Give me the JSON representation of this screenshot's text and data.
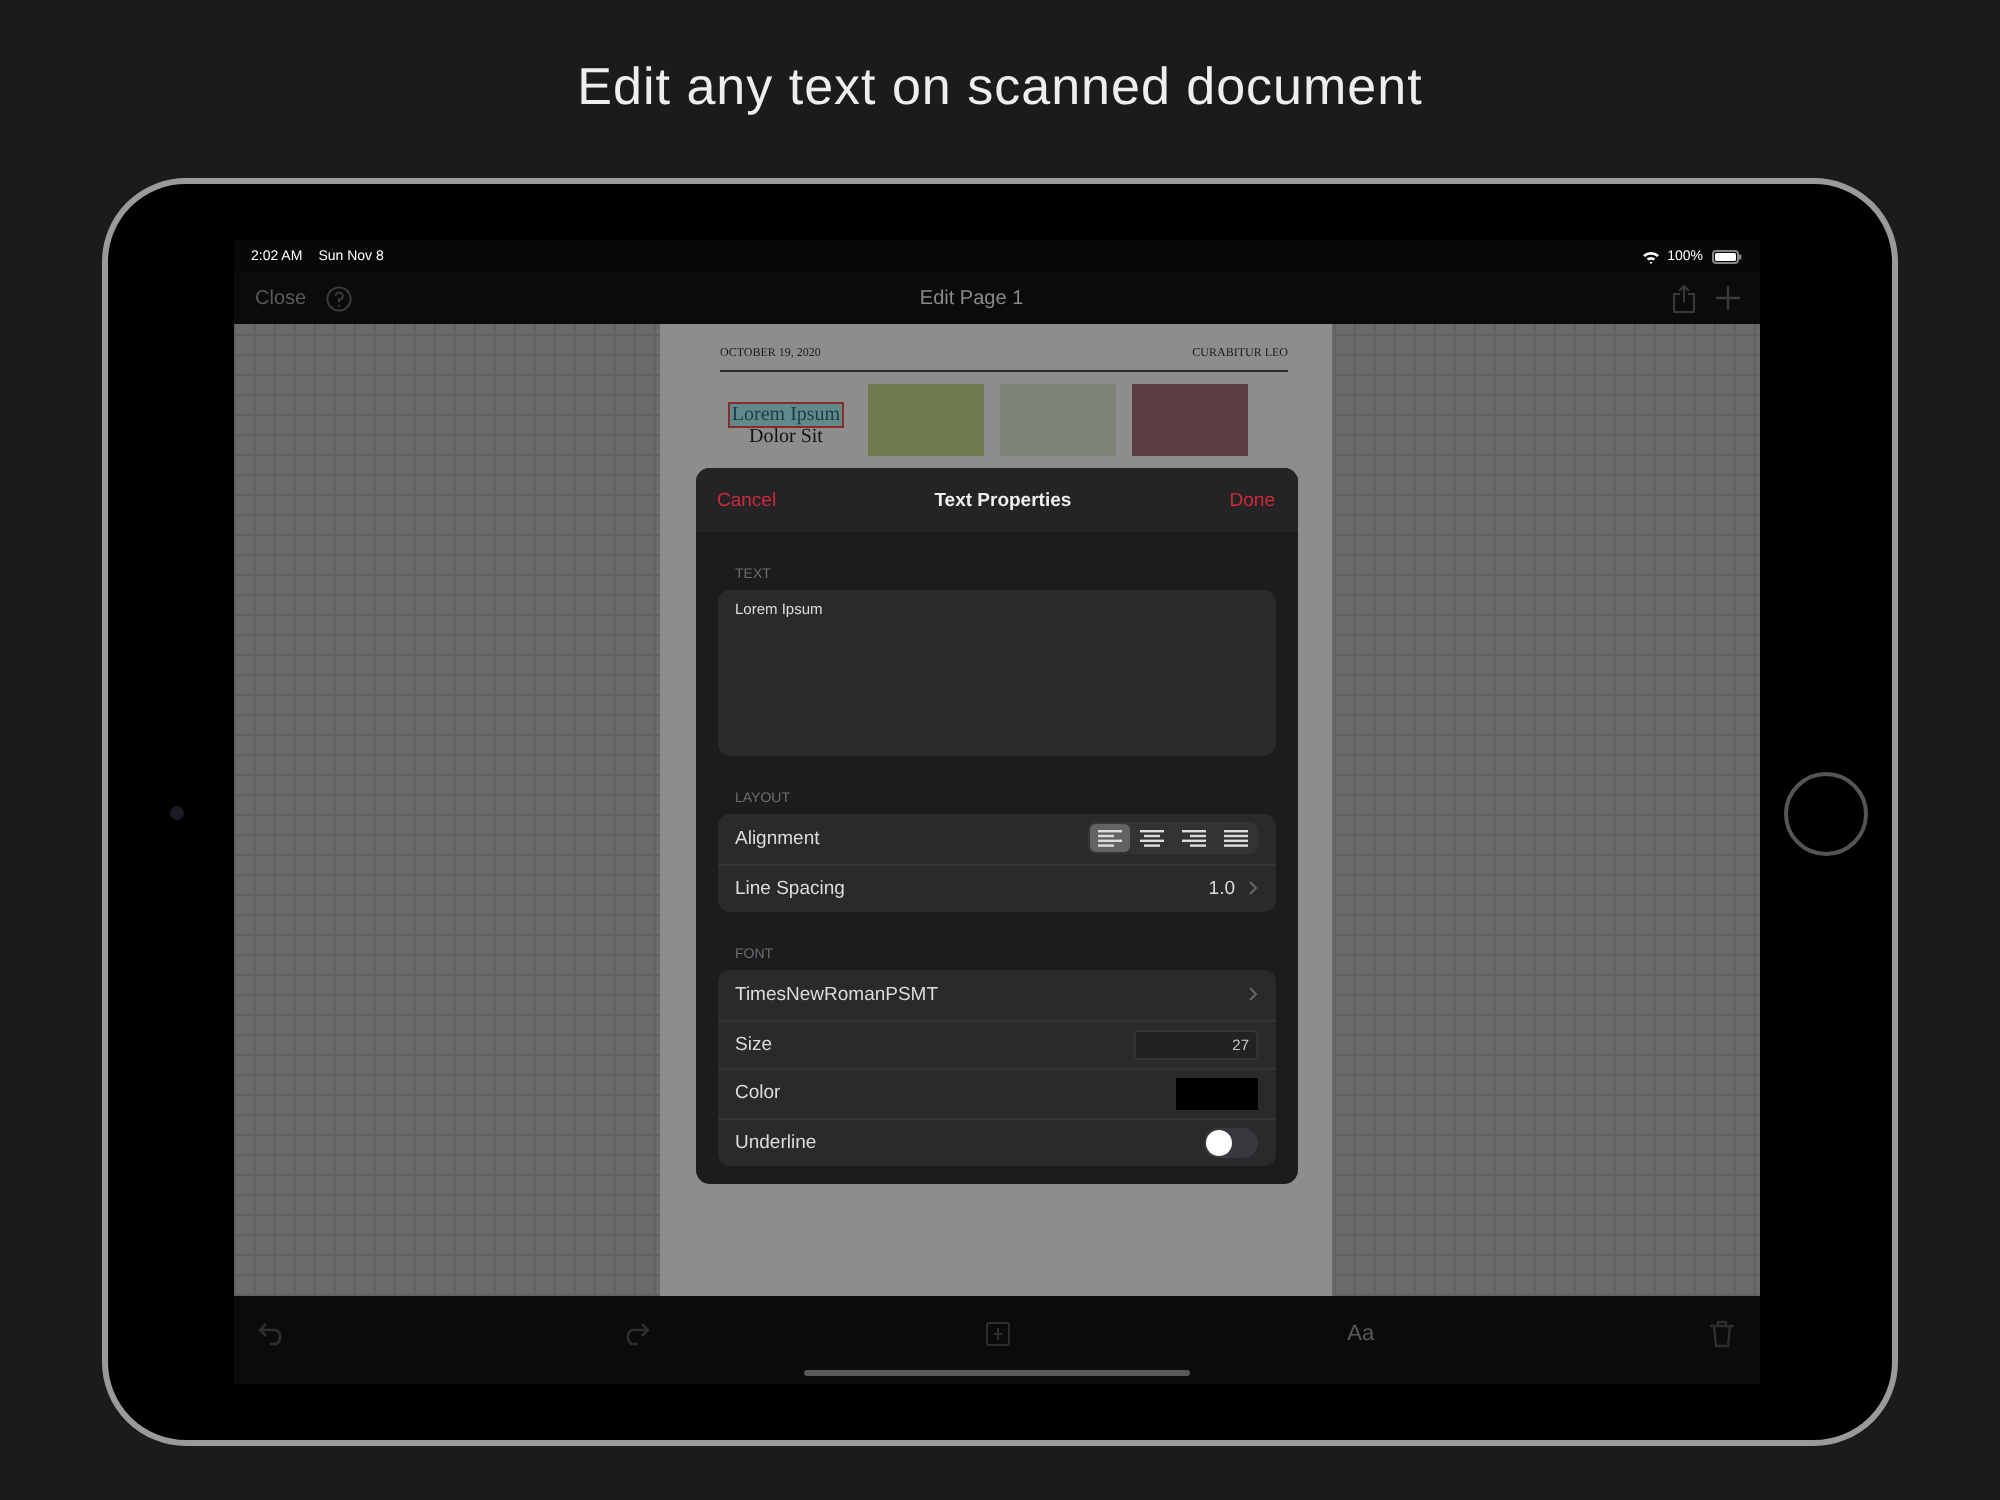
{
  "headline": "Edit any text on scanned document",
  "status_bar": {
    "time": "2:02 AM",
    "date": "Sun Nov 8",
    "battery": "100%"
  },
  "nav_bar": {
    "left": "Close",
    "title": "Edit Page 1"
  },
  "document": {
    "date": "OCTOBER 19, 2020",
    "section": "CURABITUR LEO",
    "title": "Lorem Ipsum",
    "subtitle": "Dolor Sit"
  },
  "sheet": {
    "cancel": "Cancel",
    "title": "Text Properties",
    "done": "Done",
    "text_section": {
      "label": "TEXT",
      "value": "Lorem Ipsum"
    },
    "layout_section": {
      "label": "LAYOUT",
      "alignment_label": "Alignment",
      "alignments": [
        {
          "kind": "left",
          "selected": true
        },
        {
          "kind": "center",
          "selected": false
        },
        {
          "kind": "right",
          "selected": false
        },
        {
          "kind": "justify",
          "selected": false
        }
      ],
      "line_spacing_label": "Line Spacing",
      "line_spacing": "1.0"
    },
    "font_section": {
      "label": "FONT",
      "font": "TimesNewRomanPSMT",
      "size_label": "Size",
      "size": "27",
      "color_label": "Color",
      "color": "#000000",
      "underline_label": "Underline",
      "underline": false
    }
  },
  "toolbar": {
    "font_button": "Aa"
  }
}
